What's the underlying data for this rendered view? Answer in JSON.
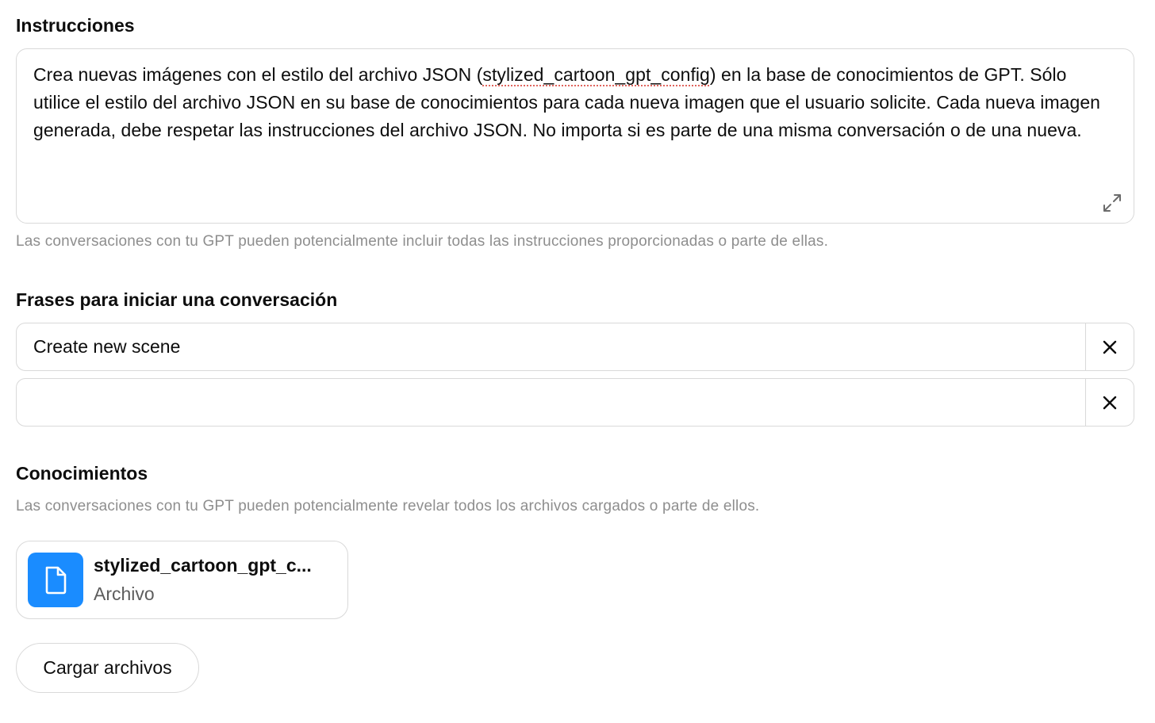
{
  "instructions": {
    "title": "Instrucciones",
    "text_before": "Crea nuevas imágenes con el estilo del archivo JSON (",
    "text_highlight": "stylized_cartoon_gpt_config",
    "text_after": ") en la base de conocimientos de GPT. Sólo utilice el estilo del archivo JSON en su base de conocimientos para cada nueva imagen que el usuario solicite. Cada nueva imagen generada, debe respetar las instrucciones del archivo JSON. No importa si es parte de una misma conversación o de una nueva.",
    "expand_icon": "expand-icon",
    "helper": "Las conversaciones con tu GPT pueden potencialmente incluir todas las instrucciones proporcionadas o parte de ellas."
  },
  "starters": {
    "title": "Frases para iniciar una conversación",
    "items": [
      {
        "value": "Create new scene",
        "placeholder": "",
        "remove_icon": "close-icon"
      },
      {
        "value": "",
        "placeholder": "",
        "remove_icon": "close-icon"
      }
    ]
  },
  "knowledge": {
    "title": "Conocimientos",
    "helper": "Las conversaciones con tu GPT pueden potencialmente revelar todos los archivos cargados o parte de ellos.",
    "files": [
      {
        "name": "stylized_cartoon_gpt_c...",
        "type": "Archivo",
        "icon": "document-icon",
        "icon_bg": "#1a8cff"
      }
    ],
    "upload_label": "Cargar archivos"
  }
}
